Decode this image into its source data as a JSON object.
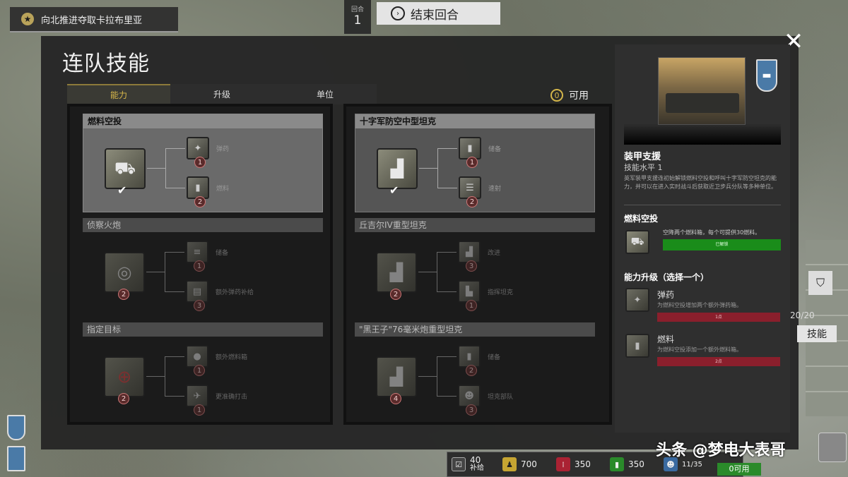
{
  "top": {
    "objective": "向北推进夺取卡拉布里亚",
    "round_label": "回合",
    "round_value": "1",
    "end_turn": "结束回合"
  },
  "modal": {
    "title": "连队技能",
    "tabs": [
      "能力",
      "升级",
      "单位"
    ],
    "available_count": "0",
    "available_label": "可用"
  },
  "cards_left": [
    {
      "title": "燃料空投",
      "icon": "fuel-airdrop-icon",
      "level": "",
      "unlocked": true,
      "subs": [
        {
          "label": "弹药",
          "num": "1"
        },
        {
          "label": "燃料",
          "num": "2"
        }
      ]
    },
    {
      "title": "侦察火炮",
      "icon": "recon-artillery-icon",
      "level": "2",
      "unlocked": false,
      "subs": [
        {
          "label": "储备",
          "num": "1"
        },
        {
          "label": "额外弹药补给",
          "num": "3"
        }
      ]
    },
    {
      "title": "指定目标",
      "icon": "target-icon",
      "level": "2",
      "unlocked": false,
      "subs": [
        {
          "label": "额外燃料箱",
          "num": "1"
        },
        {
          "label": "更准确打击",
          "num": "1"
        }
      ]
    }
  ],
  "cards_right": [
    {
      "title": "十字军防空中型坦克",
      "icon": "aa-tank-icon",
      "level": "",
      "unlocked": true,
      "subs": [
        {
          "label": "储备",
          "num": "1"
        },
        {
          "label": "速射",
          "num": "2"
        }
      ]
    },
    {
      "title": "丘吉尔IV重型坦克",
      "icon": "churchill-tank-icon",
      "level": "2",
      "unlocked": false,
      "subs": [
        {
          "label": "改进",
          "num": "3"
        },
        {
          "label": "指挥坦克",
          "num": "1"
        }
      ]
    },
    {
      "title": "\"黑王子\"76毫米炮重型坦克",
      "icon": "black-prince-tank-icon",
      "level": "4",
      "unlocked": false,
      "subs": [
        {
          "label": "储备",
          "num": "2"
        },
        {
          "label": "坦克部队",
          "num": "3"
        }
      ]
    }
  ],
  "detail": {
    "name": "装甲支援",
    "level": "技能水平 1",
    "desc": "英军装甲支援连初始解锁燃料空投和呼叫十字军防空坦克的能力，并可以在进入实时战斗后获取近卫步兵分队等多种单位。",
    "section": "燃料空投",
    "fuel_desc": "空降两个燃料箱，每个可提供30燃料。",
    "fuel_status": "已解锁",
    "upgrade_title": "能力升级（选择一个）",
    "upgrades": [
      {
        "name": "弹药",
        "desc": "为燃料空投增加两个额外弹药箱。",
        "cost": "1点"
      },
      {
        "name": "燃料",
        "desc": "为燃料空投添加一个额外燃料箱。",
        "cost": "2点"
      }
    ]
  },
  "hud": {
    "supply_value": "40",
    "supply_label": "补给",
    "manpower": "700",
    "munitions": "350",
    "fuel": "350",
    "pop": "11/35",
    "available": "0可用"
  },
  "side": {
    "count": "20/20",
    "skills_button": "技能"
  },
  "watermark": "头条 @梦电大表哥"
}
